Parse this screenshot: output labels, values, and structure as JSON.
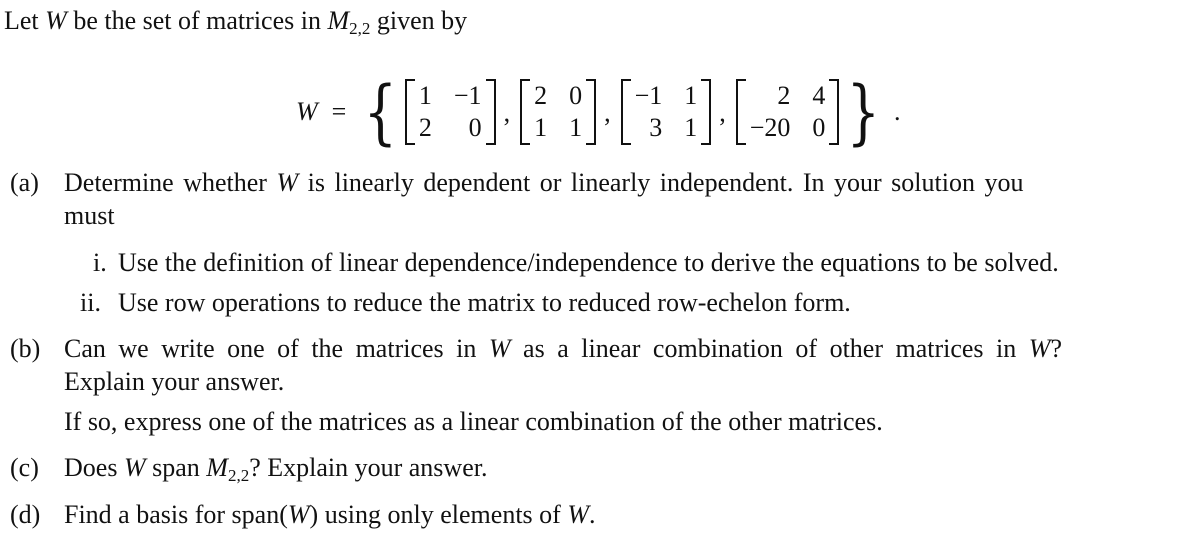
{
  "intro": {
    "text_pre": "Let ",
    "var": "W",
    "text_mid": " be the set of matrices in ",
    "space": "M",
    "space_sub": "2,2",
    "text_post": " given by"
  },
  "equation": {
    "lhs": "W",
    "eq": "=",
    "open": "{",
    "close": "}",
    "end": ".",
    "matrices": [
      [
        [
          "1",
          "−1"
        ],
        [
          "2",
          "0"
        ]
      ],
      [
        [
          "2",
          "0"
        ],
        [
          "1",
          "1"
        ]
      ],
      [
        [
          "−1",
          "1"
        ],
        [
          "3",
          "1"
        ]
      ],
      [
        [
          "2",
          "4"
        ],
        [
          "−20",
          "0"
        ]
      ]
    ]
  },
  "parts": {
    "a": {
      "label": "(a)",
      "line1_pre": "Determine whether ",
      "var": "W",
      "line1_post": " is linearly dependent or linearly independent.  In your solution you",
      "line2": "must",
      "subitems": [
        {
          "label": "i.",
          "text": "Use the definition of linear dependence/independence to derive the equations to be solved."
        },
        {
          "label": "ii.",
          "text": "Use row operations to reduce the matrix to reduced row-echelon form."
        }
      ]
    },
    "b": {
      "label": "(b)",
      "line1_pre": "Can we write one of the matrices in ",
      "var": "W",
      "line1_mid": " as a linear combination of other matrices in ",
      "var2": "W",
      "line1_post": "?",
      "line2": "Explain your answer.",
      "line3": "If so, express one of the matrices as a linear combination of the other matrices."
    },
    "c": {
      "label": "(c)",
      "pre": "Does ",
      "var": "W",
      "mid": " span ",
      "space": "M",
      "space_sub": "2,2",
      "post": "? Explain your answer."
    },
    "d": {
      "label": "(d)",
      "pre": "Find a basis for span(",
      "var": "W",
      "mid": ") using only elements of ",
      "var2": "W",
      "post": "."
    }
  }
}
